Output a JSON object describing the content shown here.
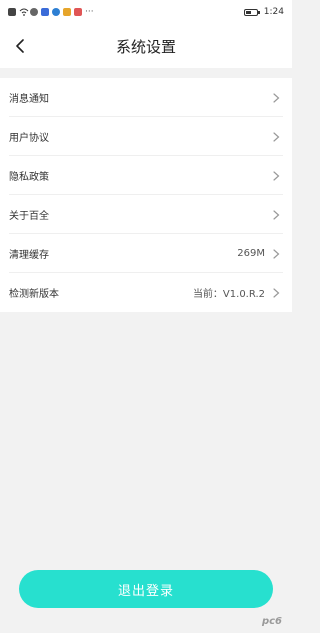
{
  "status_bar": {
    "time": "1:24",
    "icons": [
      "notification-icon",
      "wifi-icon",
      "app-icon-1",
      "app-icon-2",
      "app-icon-3",
      "app-icon-4",
      "app-icon-5",
      "more-icon"
    ],
    "more": "···"
  },
  "header": {
    "title": "系统设置"
  },
  "settings": {
    "items": [
      {
        "label": "消息通知",
        "value": ""
      },
      {
        "label": "用户协议",
        "value": ""
      },
      {
        "label": "隐私政策",
        "value": ""
      },
      {
        "label": "关于百全",
        "value": ""
      },
      {
        "label": "清理缓存",
        "value": "269M"
      },
      {
        "label": "检测新版本",
        "value": "当前：V1.0.R.2"
      }
    ]
  },
  "logout": {
    "label": "退出登录"
  },
  "colors": {
    "accent": "#27e0cf",
    "background": "#f2f2f2"
  }
}
